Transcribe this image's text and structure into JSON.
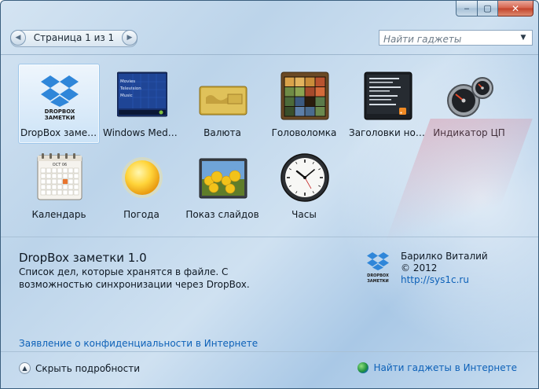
{
  "window": {
    "title": "",
    "caption_buttons": {
      "minimize": "‒",
      "maximize": "▢",
      "close": "✕"
    }
  },
  "pager": {
    "text": "Страница 1 из 1",
    "prev_icon": "◀",
    "next_icon": "▶"
  },
  "search": {
    "placeholder": "Найти гаджеты",
    "dropdown_icon": "▼"
  },
  "gadgets": [
    {
      "label": "DropBox заметки",
      "icon": "dropbox-icon",
      "selected": true
    },
    {
      "label": "Windows Media Center",
      "icon": "media-center-icon",
      "selected": false,
      "thumb_lines": [
        "Movies",
        "Television",
        "Music"
      ]
    },
    {
      "label": "Валюта",
      "icon": "currency-icon",
      "selected": false
    },
    {
      "label": "Головоломка",
      "icon": "puzzle-icon",
      "selected": false
    },
    {
      "label": "Заголовки новостей",
      "icon": "news-headlines-icon",
      "selected": false
    },
    {
      "label": "Индикатор ЦП",
      "icon": "cpu-meter-icon",
      "selected": false
    },
    {
      "label": "Календарь",
      "icon": "calendar-icon",
      "selected": false,
      "thumb_month": "OCT 06"
    },
    {
      "label": "Погода",
      "icon": "weather-sun-icon",
      "selected": false
    },
    {
      "label": "Показ слайдов",
      "icon": "slideshow-icon",
      "selected": false
    },
    {
      "label": "Часы",
      "icon": "clock-icon",
      "selected": false
    }
  ],
  "dropbox_logo_text": [
    "DROPBOX",
    "ЗАМЕТКИ"
  ],
  "details": {
    "name": "DropBox заметки 1.0",
    "description": "Список дел, которые хранятся в файле. С возможностью синхронизации через DropBox.",
    "author": "Барилко Виталий",
    "copyright": "© 2012",
    "url": "http://sys1c.ru",
    "privacy_link": "Заявление о конфиденциальности в Интернете"
  },
  "bottom": {
    "toggle_label": "Скрыть подробности",
    "toggle_icon": "▲",
    "online_link": "Найти гаджеты в Интернете"
  },
  "colors": {
    "link": "#0d61b8",
    "dropbox_blue": "#2f86d9",
    "selection": "#cfe5f9"
  }
}
